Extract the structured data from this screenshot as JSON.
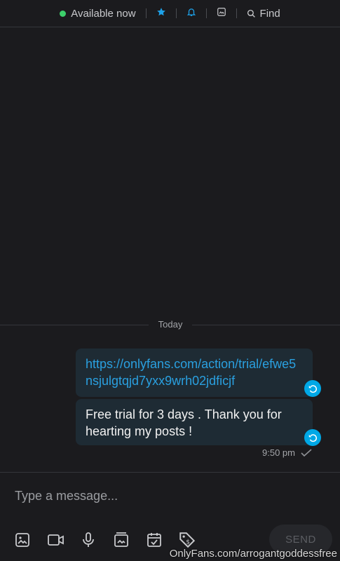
{
  "header": {
    "status_text": "Available now",
    "find_label": "Find"
  },
  "chat": {
    "date_divider": "Today",
    "messages": [
      {
        "text": "https://onlyfans.com/action/trial/efwe5nsjulgtqjd7yxx9wrh02jdficjf",
        "type": "link"
      },
      {
        "text": "Free trial for 3 days . Thank you for hearting my posts !",
        "type": "text"
      }
    ],
    "time": "9:50 pm"
  },
  "composer": {
    "placeholder": "Type a message...",
    "send_label": "SEND"
  },
  "watermark": "OnlyFans.com/arrogantgoddessfree",
  "colors": {
    "accent": "#00a8e6",
    "online": "#3ccf6a",
    "bubble": "#1e2b34",
    "background": "#1b1b1e"
  }
}
